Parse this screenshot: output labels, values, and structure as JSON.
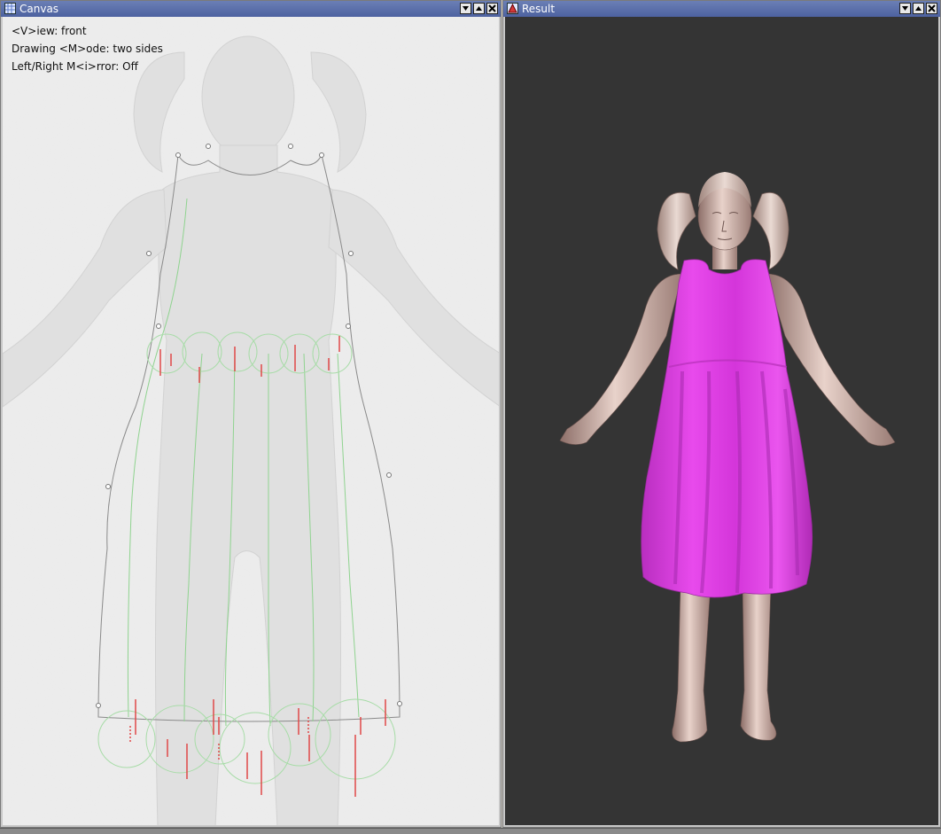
{
  "canvas_window": {
    "title": "Canvas",
    "info": {
      "view_line": "<V>iew: front",
      "mode_line": "Drawing <M>ode: two sides",
      "mirror_line": "Left/Right M<i>rror: Off"
    }
  },
  "result_window": {
    "title": "Result"
  },
  "colors": {
    "titlebar": "#4d62a0",
    "canvas_bg": "#ececec",
    "result_bg": "#343434",
    "dress": "#e23ce6",
    "skin": "#d9bfb7"
  },
  "icons": {
    "canvas": "grid-window-icon",
    "result": "render-window-icon",
    "minimize": "triangle-down-icon",
    "maximize": "triangle-up-icon",
    "close": "x-icon"
  }
}
